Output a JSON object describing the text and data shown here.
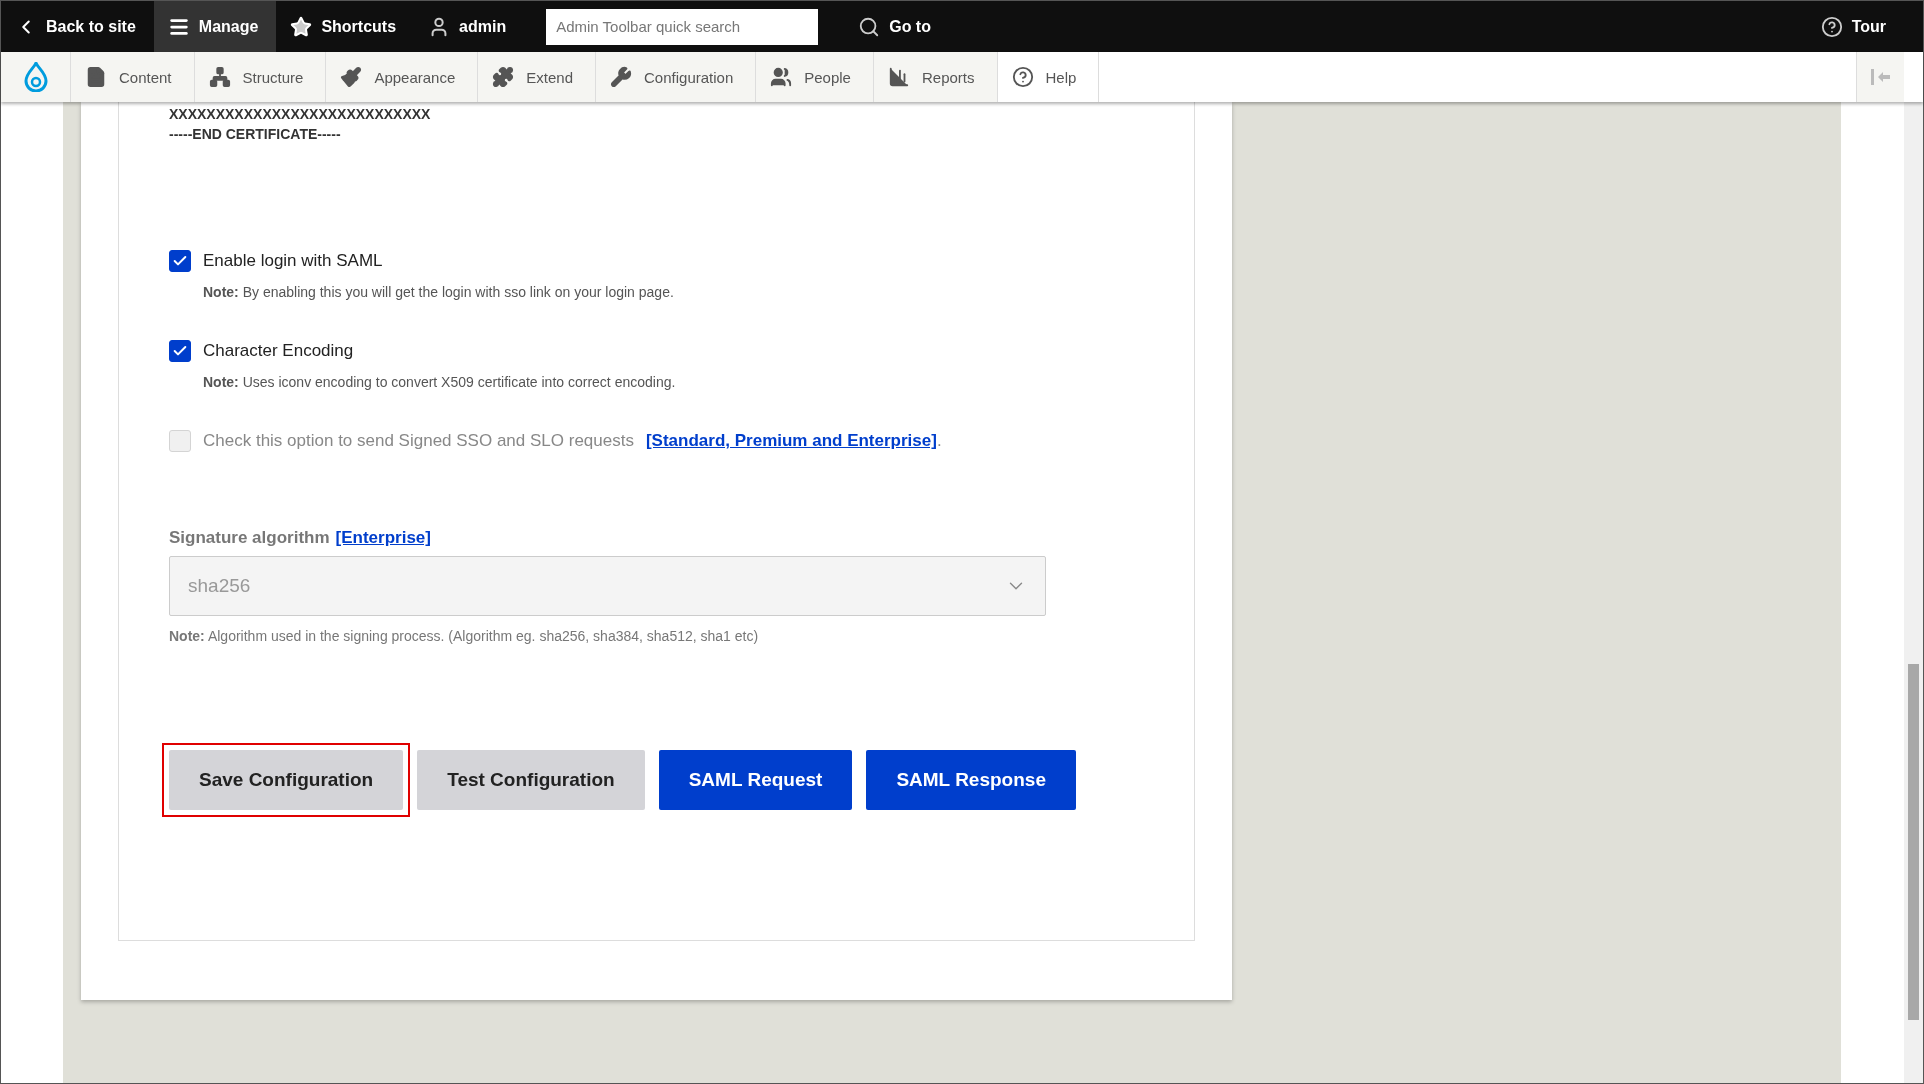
{
  "toolbar": {
    "items": [
      {
        "kind": "back",
        "label": "Back to site",
        "selected": false
      },
      {
        "kind": "menu",
        "label": "Manage",
        "selected": true
      },
      {
        "kind": "star",
        "label": "Shortcuts",
        "selected": false
      },
      {
        "kind": "user",
        "label": "admin",
        "selected": false
      }
    ],
    "search": {
      "placeholder": "Admin Toolbar quick search"
    },
    "goto": "Go to",
    "tour": "Tour"
  },
  "tray": {
    "items": [
      {
        "kind": "content",
        "label": "Content"
      },
      {
        "kind": "structure",
        "label": "Structure"
      },
      {
        "kind": "appearance",
        "label": "Appearance"
      },
      {
        "kind": "extend",
        "label": "Extend"
      },
      {
        "kind": "configuration",
        "label": "Configuration"
      },
      {
        "kind": "people",
        "label": "People"
      },
      {
        "kind": "reports",
        "label": "Reports"
      },
      {
        "kind": "help",
        "label": "Help"
      }
    ]
  },
  "certificate": [
    "XXXXXXXXXXXXXXXXXXXXXXXXXXXX",
    "-----END CERTIFICATE-----"
  ],
  "options": [
    {
      "label": "Enable login with SAML",
      "checked": true,
      "disabled": false,
      "note_label": "Note:",
      "note": "By enabling this you will get the login with sso link on your login page."
    },
    {
      "label": "Character Encoding",
      "checked": true,
      "disabled": false,
      "note_label": "Note:",
      "note": "Uses iconv encoding to convert X509 certificate into correct encoding."
    },
    {
      "label": "Check this option to send Signed SSO and SLO requests",
      "checked": false,
      "disabled": true,
      "link": "[Standard, Premium and Enterprise]",
      "suffix": "."
    }
  ],
  "signature": {
    "label": "Signature algorithm",
    "link": "[Enterprise]",
    "value": "sha256",
    "disabled": true,
    "note_label": "Note:",
    "note": "Algorithm used in the signing process. (Algorithm eg. sha256, sha384, sha512, sha1 etc)"
  },
  "buttons": [
    {
      "label": "Save Configuration",
      "kind": "secondary",
      "highlighted": true
    },
    {
      "label": "Test Configuration",
      "kind": "secondary",
      "highlighted": false
    },
    {
      "label": "SAML Request",
      "kind": "primary",
      "highlighted": false
    },
    {
      "label": "SAML Response",
      "kind": "primary",
      "highlighted": false
    }
  ]
}
